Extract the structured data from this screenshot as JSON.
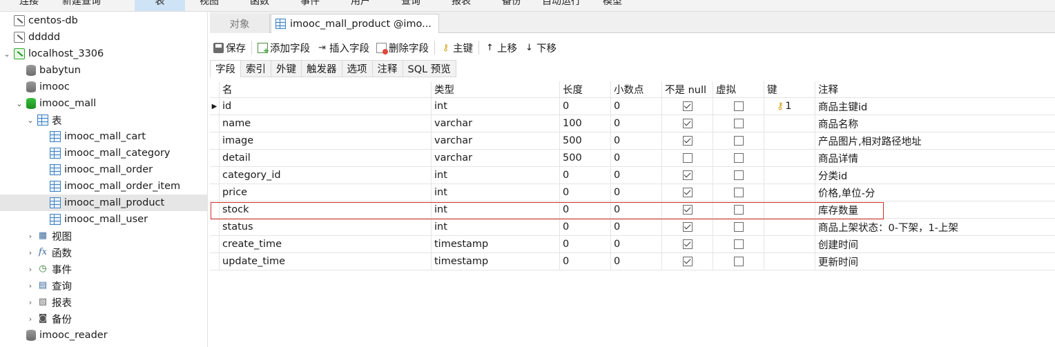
{
  "menubar": {
    "items": [
      {
        "label": "连接",
        "active": false
      },
      {
        "label": "新建查询",
        "active": false
      },
      {
        "label": "表",
        "active": true
      },
      {
        "label": "视图",
        "active": false
      },
      {
        "label": "函数",
        "active": false
      },
      {
        "label": "事件",
        "active": false
      },
      {
        "label": "用户",
        "active": false
      },
      {
        "label": "查询",
        "active": false
      },
      {
        "label": "报表",
        "active": false
      },
      {
        "label": "备份",
        "active": false
      },
      {
        "label": "自动运行",
        "active": false
      },
      {
        "label": "模型",
        "active": false
      }
    ]
  },
  "sidebar": {
    "items": [
      {
        "label": "centos-db",
        "icon": "connection-icon"
      },
      {
        "label": "ddddd",
        "icon": "connection-icon"
      },
      {
        "label": "localhost_3306",
        "icon": "connection-active-icon",
        "arrow": "expanded"
      },
      {
        "label": "babytun",
        "icon": "database-icon"
      },
      {
        "label": "imooc",
        "icon": "database-icon"
      },
      {
        "label": "imooc_mall",
        "icon": "database-active-icon",
        "arrow": "expanded"
      },
      {
        "label": "表",
        "icon": "tables-folder-icon",
        "arrow": "expanded"
      },
      {
        "label": "imooc_mall_cart",
        "icon": "table-icon"
      },
      {
        "label": "imooc_mall_category",
        "icon": "table-icon"
      },
      {
        "label": "imooc_mall_order",
        "icon": "table-icon"
      },
      {
        "label": "imooc_mall_order_item",
        "icon": "table-icon"
      },
      {
        "label": "imooc_mall_product",
        "icon": "table-icon",
        "selected": true
      },
      {
        "label": "imooc_mall_user",
        "icon": "table-icon"
      },
      {
        "label": "视图",
        "icon": "views-icon",
        "arrow": "collapsed"
      },
      {
        "label": "函数",
        "icon": "functions-icon",
        "arrow": "collapsed"
      },
      {
        "label": "事件",
        "icon": "events-icon",
        "arrow": "collapsed"
      },
      {
        "label": "查询",
        "icon": "queries-icon",
        "arrow": "collapsed"
      },
      {
        "label": "报表",
        "icon": "reports-icon",
        "arrow": "collapsed"
      },
      {
        "label": "备份",
        "icon": "backups-icon",
        "arrow": "collapsed"
      },
      {
        "label": "imooc_reader",
        "icon": "database-icon"
      }
    ]
  },
  "tabs": {
    "objects": "对象",
    "current": "imooc_mall_product @imo..."
  },
  "toolbar": {
    "save": "保存",
    "add_field": "添加字段",
    "insert_field": "插入字段",
    "delete_field": "删除字段",
    "primary_key": "主键",
    "move_up": "上移",
    "move_down": "下移"
  },
  "subtabs": [
    "字段",
    "索引",
    "外键",
    "触发器",
    "选项",
    "注释",
    "SQL 预览"
  ],
  "grid": {
    "headers": {
      "name": "名",
      "type": "类型",
      "length": "长度",
      "decimals": "小数点",
      "not_null": "不是 null",
      "virtual": "虚拟",
      "key": "键",
      "comment": "注释"
    },
    "rows": [
      {
        "name": "id",
        "type": "int",
        "length": "0",
        "decimals": "0",
        "not_null": true,
        "virtual": false,
        "key": "1",
        "comment": "商品主键id"
      },
      {
        "name": "name",
        "type": "varchar",
        "length": "100",
        "decimals": "0",
        "not_null": true,
        "virtual": false,
        "key": "",
        "comment": "商品名称"
      },
      {
        "name": "image",
        "type": "varchar",
        "length": "500",
        "decimals": "0",
        "not_null": true,
        "virtual": false,
        "key": "",
        "comment": "产品图片,相对路径地址"
      },
      {
        "name": "detail",
        "type": "varchar",
        "length": "500",
        "decimals": "0",
        "not_null": false,
        "virtual": false,
        "key": "",
        "comment": "商品详情"
      },
      {
        "name": "category_id",
        "type": "int",
        "length": "0",
        "decimals": "0",
        "not_null": true,
        "virtual": false,
        "key": "",
        "comment": "分类id"
      },
      {
        "name": "price",
        "type": "int",
        "length": "0",
        "decimals": "0",
        "not_null": true,
        "virtual": false,
        "key": "",
        "comment": "价格,单位-分"
      },
      {
        "name": "stock",
        "type": "int",
        "length": "0",
        "decimals": "0",
        "not_null": true,
        "virtual": false,
        "key": "",
        "comment": "库存数量"
      },
      {
        "name": "status",
        "type": "int",
        "length": "0",
        "decimals": "0",
        "not_null": true,
        "virtual": false,
        "key": "",
        "comment": "商品上架状态：0-下架，1-上架"
      },
      {
        "name": "create_time",
        "type": "timestamp",
        "length": "0",
        "decimals": "0",
        "not_null": true,
        "virtual": false,
        "key": "",
        "comment": "创建时间"
      },
      {
        "name": "update_time",
        "type": "timestamp",
        "length": "0",
        "decimals": "0",
        "not_null": true,
        "virtual": false,
        "key": "",
        "comment": "更新时间"
      }
    ]
  },
  "colors": {
    "highlight": "#d0302b",
    "selection": "#e6e6e6",
    "key_icon": "#d4a017"
  }
}
